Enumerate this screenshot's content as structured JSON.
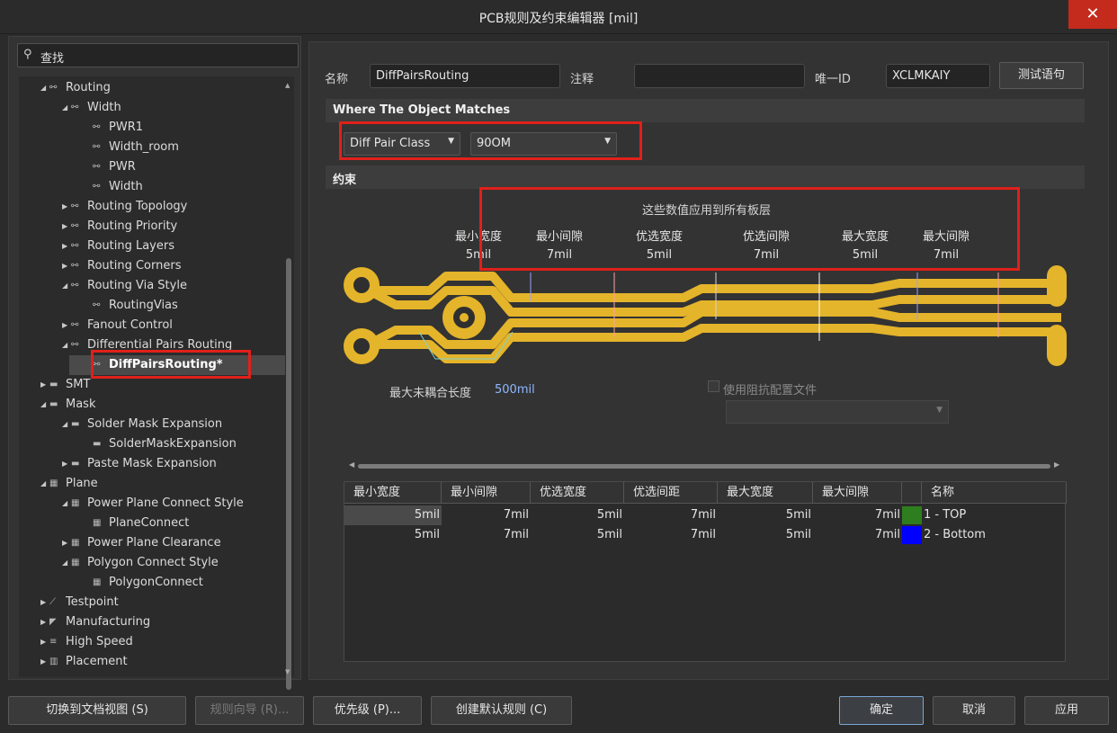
{
  "window": {
    "title": "PCB规则及约束编辑器 [mil]",
    "close_glyph": "✕"
  },
  "search": {
    "placeholder": "查找"
  },
  "tree": [
    {
      "label": "Routing",
      "arrow": "◢",
      "icon": "⚯",
      "indent": 0
    },
    {
      "label": "Width",
      "arrow": "◢",
      "icon": "⚯",
      "indent": 1
    },
    {
      "label": "PWR1",
      "arrow": "",
      "icon": "⚯",
      "indent": 2
    },
    {
      "label": "Width_room",
      "arrow": "",
      "icon": "⚯",
      "indent": 2
    },
    {
      "label": "PWR",
      "arrow": "",
      "icon": "⚯",
      "indent": 2
    },
    {
      "label": "Width",
      "arrow": "",
      "icon": "⚯",
      "indent": 2
    },
    {
      "label": "Routing Topology",
      "arrow": "▶",
      "icon": "⚯",
      "indent": 1
    },
    {
      "label": "Routing Priority",
      "arrow": "▶",
      "icon": "⚯",
      "indent": 1
    },
    {
      "label": "Routing Layers",
      "arrow": "▶",
      "icon": "⚯",
      "indent": 1
    },
    {
      "label": "Routing Corners",
      "arrow": "▶",
      "icon": "⚯",
      "indent": 1
    },
    {
      "label": "Routing Via Style",
      "arrow": "◢",
      "icon": "⚯",
      "indent": 1
    },
    {
      "label": "RoutingVias",
      "arrow": "",
      "icon": "⚯",
      "indent": 2
    },
    {
      "label": "Fanout Control",
      "arrow": "▶",
      "icon": "⚯",
      "indent": 1
    },
    {
      "label": "Differential Pairs Routing",
      "arrow": "◢",
      "icon": "⚯",
      "indent": 1
    },
    {
      "label": "DiffPairsRouting*",
      "arrow": "",
      "icon": "⚯",
      "indent": 2,
      "selected": true
    },
    {
      "label": "SMT",
      "arrow": "▶",
      "icon": "▬",
      "indent": 0
    },
    {
      "label": "Mask",
      "arrow": "◢",
      "icon": "▬",
      "indent": 0
    },
    {
      "label": "Solder Mask Expansion",
      "arrow": "◢",
      "icon": "▬",
      "indent": 1
    },
    {
      "label": "SolderMaskExpansion",
      "arrow": "",
      "icon": "▬",
      "indent": 2
    },
    {
      "label": "Paste Mask Expansion",
      "arrow": "▶",
      "icon": "▬",
      "indent": 1
    },
    {
      "label": "Plane",
      "arrow": "◢",
      "icon": "▦",
      "indent": 0
    },
    {
      "label": "Power Plane Connect Style",
      "arrow": "◢",
      "icon": "▦",
      "indent": 1
    },
    {
      "label": "PlaneConnect",
      "arrow": "",
      "icon": "▦",
      "indent": 2
    },
    {
      "label": "Power Plane Clearance",
      "arrow": "▶",
      "icon": "▦",
      "indent": 1
    },
    {
      "label": "Polygon Connect Style",
      "arrow": "◢",
      "icon": "▦",
      "indent": 1
    },
    {
      "label": "PolygonConnect",
      "arrow": "",
      "icon": "▦",
      "indent": 2
    },
    {
      "label": "Testpoint",
      "arrow": "▶",
      "icon": "⟋",
      "indent": 0
    },
    {
      "label": "Manufacturing",
      "arrow": "▶",
      "icon": "◤",
      "indent": 0
    },
    {
      "label": "High Speed",
      "arrow": "▶",
      "icon": "≡",
      "indent": 0
    },
    {
      "label": "Placement",
      "arrow": "▶",
      "icon": "▥",
      "indent": 0
    }
  ],
  "form": {
    "name_label": "名称",
    "name_value": "DiffPairsRouting",
    "comment_label": "注释",
    "comment_value": "",
    "uid_label": "唯一ID",
    "uid_value": "XCLMKAIY",
    "test_button": "测试语句"
  },
  "where": {
    "heading": "Where The Object Matches",
    "scope": "Diff Pair Class",
    "value": "90OM"
  },
  "constraints": {
    "heading": "约束",
    "note": "这些数值应用到所有板层",
    "headers": [
      "最小宽度",
      "最小间隙",
      "优选宽度",
      "优选间隙",
      "最大宽度",
      "最大间隙"
    ],
    "values": [
      "5mil",
      "7mil",
      "5mil",
      "7mil",
      "5mil",
      "7mil"
    ],
    "uncoupled_label": "最大未耦合长度",
    "uncoupled_value": "500mil",
    "impedance_label": "使用阻抗配置文件"
  },
  "layer_table": {
    "columns": [
      "最小宽度",
      "最小间隙",
      "优选宽度",
      "优选间距",
      "最大宽度",
      "最大间隙",
      "",
      "名称"
    ],
    "rows": [
      {
        "cells": [
          "5mil",
          "7mil",
          "5mil",
          "7mil",
          "5mil",
          "7mil"
        ],
        "color": "#2e7d1e",
        "name": "1 - TOP"
      },
      {
        "cells": [
          "5mil",
          "7mil",
          "5mil",
          "7mil",
          "5mil",
          "7mil"
        ],
        "color": "#0000ff",
        "name": "2 - Bottom"
      }
    ]
  },
  "buttons": {
    "doc_view": "切换到文档视图 (S)",
    "wizard": "规则向导 (R)...",
    "priority": "优先级 (P)...",
    "create_default": "创建默认规则 (C)",
    "ok": "确定",
    "cancel": "取消",
    "apply": "应用"
  },
  "colors": {
    "trace": "#e4b42a",
    "highlight": "#e0201b"
  }
}
